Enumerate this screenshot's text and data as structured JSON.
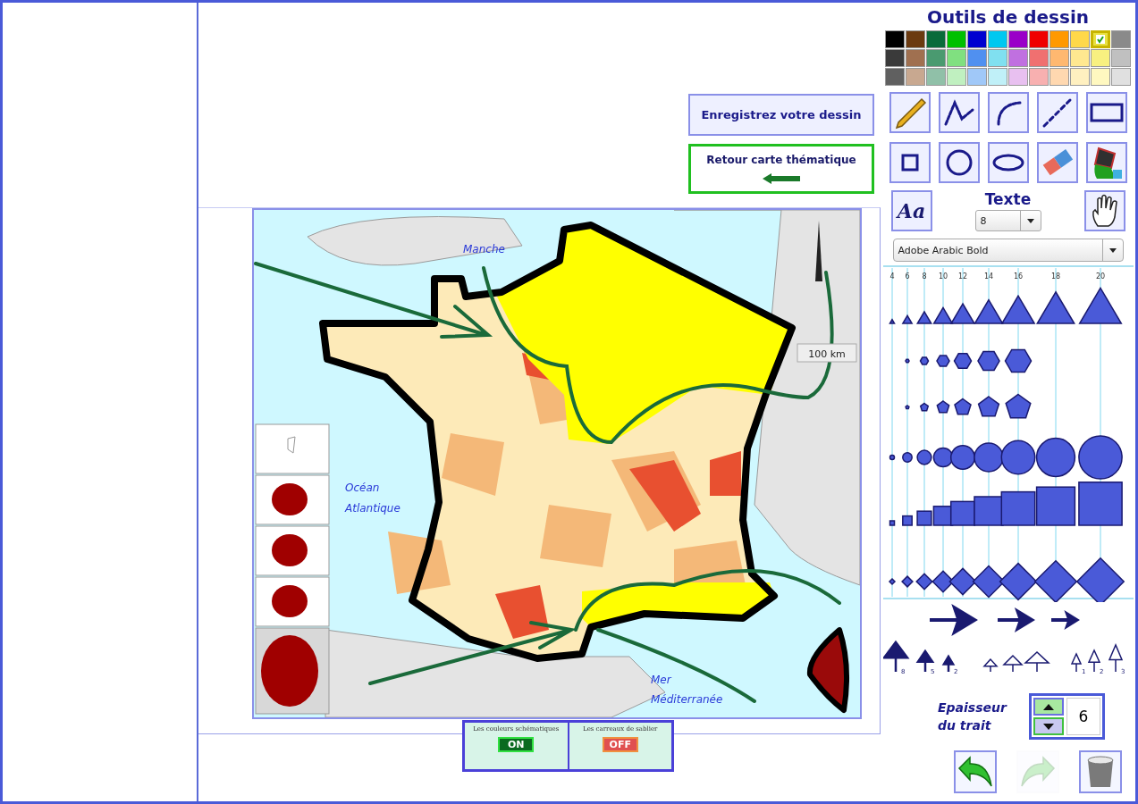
{
  "panel_title": "Outils de dessin",
  "palette": [
    {
      "color": "#000000",
      "selected": false
    },
    {
      "color": "#6b3a10",
      "selected": false
    },
    {
      "color": "#0a6b3a",
      "selected": false
    },
    {
      "color": "#00c000",
      "selected": false
    },
    {
      "color": "#0000d0",
      "selected": false
    },
    {
      "color": "#00c8f0",
      "selected": false
    },
    {
      "color": "#9a00c8",
      "selected": false
    },
    {
      "color": "#f00000",
      "selected": false
    },
    {
      "color": "#ff9900",
      "selected": false
    },
    {
      "color": "#ffd84a",
      "selected": false
    },
    {
      "color": "#e8e040",
      "selected": true
    },
    {
      "color": "#8a8a8a",
      "selected": false
    },
    {
      "color": "#3a3a3a",
      "selected": false
    },
    {
      "color": "#a07050",
      "selected": false
    },
    {
      "color": "#4a9a70",
      "selected": false
    },
    {
      "color": "#80e080",
      "selected": false
    },
    {
      "color": "#5090f0",
      "selected": false
    },
    {
      "color": "#80e0f0",
      "selected": false
    },
    {
      "color": "#c070e0",
      "selected": false
    },
    {
      "color": "#f07070",
      "selected": false
    },
    {
      "color": "#ffb870",
      "selected": false
    },
    {
      "color": "#ffe890",
      "selected": false
    },
    {
      "color": "#f8f080",
      "selected": false
    },
    {
      "color": "#c0c0c0",
      "selected": false
    },
    {
      "color": "#606060",
      "selected": false
    },
    {
      "color": "#c8a890",
      "selected": false
    },
    {
      "color": "#90c0a8",
      "selected": false
    },
    {
      "color": "#c0f0c0",
      "selected": false
    },
    {
      "color": "#a0c8f8",
      "selected": false
    },
    {
      "color": "#c0f0f8",
      "selected": false
    },
    {
      "color": "#e8c0f0",
      "selected": false
    },
    {
      "color": "#f8b0b0",
      "selected": false
    },
    {
      "color": "#ffd8b0",
      "selected": false
    },
    {
      "color": "#fff0c0",
      "selected": false
    },
    {
      "color": "#fff8c0",
      "selected": false
    },
    {
      "color": "#e0e0e0",
      "selected": false
    }
  ],
  "tools": [
    {
      "kind": "pencil"
    },
    {
      "kind": "polyline"
    },
    {
      "kind": "arc"
    },
    {
      "kind": "dashed"
    },
    {
      "kind": "rectangle"
    },
    {
      "kind": "square"
    },
    {
      "kind": "circle"
    },
    {
      "kind": "ellipse"
    },
    {
      "kind": "eraser"
    },
    {
      "kind": "fill"
    }
  ],
  "text_tool": {
    "button": "Aa",
    "label": "Texte",
    "size": "8",
    "font": "Adobe Arabic Bold"
  },
  "shape_sizes": [
    "4",
    "6",
    "8",
    "10",
    "12",
    "14",
    "16",
    "18",
    "20"
  ],
  "arrow_labels": [
    "8",
    "5",
    "2",
    "1",
    "2",
    "3"
  ],
  "stroke": {
    "label": "Epaisseur du trait",
    "value": "6"
  },
  "history_buttons": [
    {
      "kind": "undo",
      "disabled": false
    },
    {
      "kind": "redo",
      "disabled": true
    },
    {
      "kind": "clear",
      "disabled": false
    }
  ],
  "save_button": "Enregistrez votre dessin",
  "back_button": "Retour carte thématique",
  "map": {
    "labels": [
      "Manche",
      "Océan",
      "Atlantique",
      "Mer",
      "Méditerranée"
    ],
    "scale": "100 km"
  },
  "toggles": [
    {
      "label": "Les couleurs schématiques",
      "on": true,
      "text": "ON"
    },
    {
      "label": "Les carreaux de sablier",
      "on": false,
      "text": "OFF"
    }
  ]
}
